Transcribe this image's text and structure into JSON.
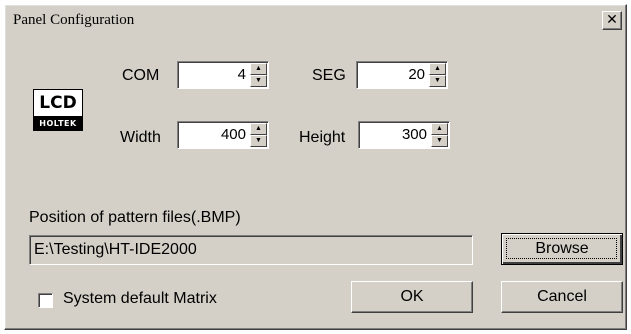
{
  "window": {
    "title": "Panel Configuration",
    "close_glyph": "✕"
  },
  "logo": {
    "top_text": "LCD",
    "bottom_text": "HOLTEK"
  },
  "fields": {
    "com": {
      "label": "COM",
      "value": "4"
    },
    "seg": {
      "label": "SEG",
      "value": "20"
    },
    "width": {
      "label": "Width",
      "value": "400"
    },
    "height": {
      "label": "Height",
      "value": "300"
    }
  },
  "spin_glyphs": {
    "up": "▲",
    "down": "▼"
  },
  "pattern": {
    "label": "Position of pattern files(.BMP)",
    "path": "E:\\Testing\\HT-IDE2000",
    "browse_label": "Browse"
  },
  "options": {
    "system_default_label": "System default Matrix",
    "system_default_checked": false
  },
  "buttons": {
    "ok_label": "OK",
    "cancel_label": "Cancel"
  }
}
